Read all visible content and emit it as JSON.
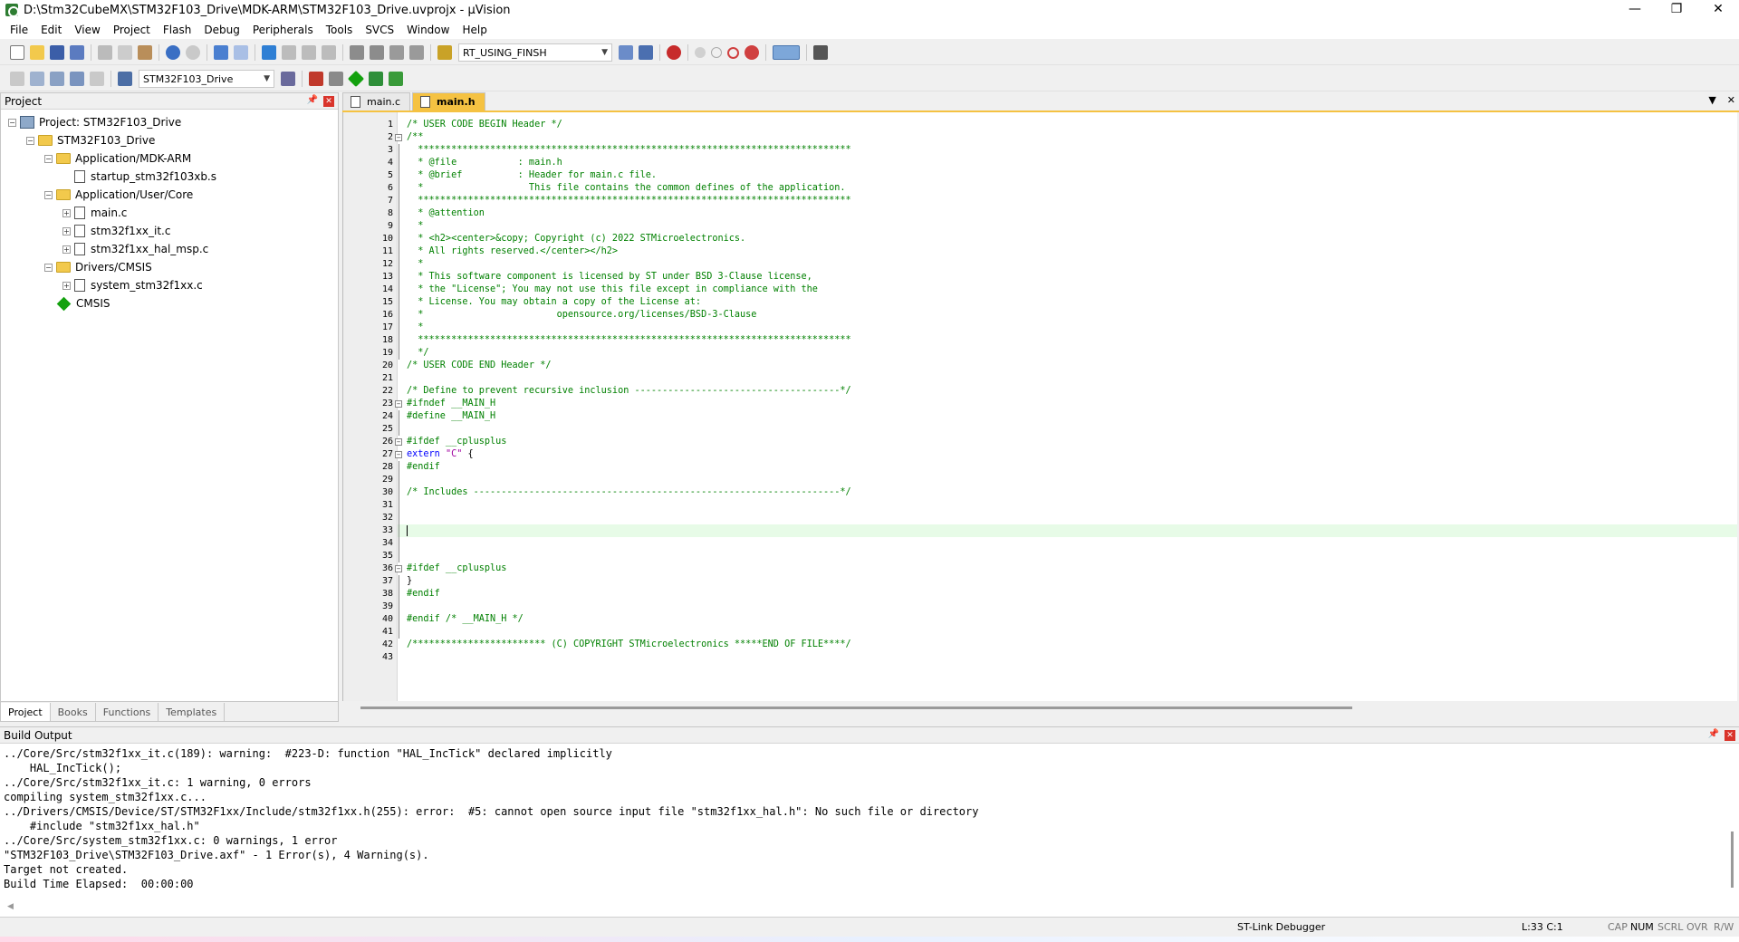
{
  "window": {
    "title": "D:\\Stm32CubeMX\\STM32F103_Drive\\MDK-ARM\\STM32F103_Drive.uvprojx - µVision",
    "min": "—",
    "max": "❐",
    "close": "✕"
  },
  "menu": [
    "File",
    "Edit",
    "View",
    "Project",
    "Flash",
    "Debug",
    "Peripherals",
    "Tools",
    "SVCS",
    "Window",
    "Help"
  ],
  "toolbar1": {
    "find_combo": "RT_USING_FINSH"
  },
  "toolbar2": {
    "target_combo": "STM32F103_Drive"
  },
  "project_panel": {
    "title": "Project",
    "tree": [
      {
        "label": "Project: STM32F103_Drive",
        "type": "project",
        "expander": "−",
        "level": 0
      },
      {
        "label": "STM32F103_Drive",
        "type": "folder",
        "expander": "−",
        "level": 1
      },
      {
        "label": "Application/MDK-ARM",
        "type": "folder",
        "expander": "−",
        "level": 2
      },
      {
        "label": "startup_stm32f103xb.s",
        "type": "file",
        "expander": "",
        "level": 3
      },
      {
        "label": "Application/User/Core",
        "type": "folder",
        "expander": "−",
        "level": 2
      },
      {
        "label": "main.c",
        "type": "file",
        "expander": "+",
        "level": 3
      },
      {
        "label": "stm32f1xx_it.c",
        "type": "file",
        "expander": "+",
        "level": 3
      },
      {
        "label": "stm32f1xx_hal_msp.c",
        "type": "file",
        "expander": "+",
        "level": 3
      },
      {
        "label": "Drivers/CMSIS",
        "type": "folder",
        "expander": "−",
        "level": 2
      },
      {
        "label": "system_stm32f1xx.c",
        "type": "file",
        "expander": "+",
        "level": 3
      },
      {
        "label": "CMSIS",
        "type": "component",
        "expander": "",
        "level": 2
      }
    ],
    "tabs": [
      "Project",
      "Books",
      "Functions",
      "Templates"
    ],
    "active_tab": "Project"
  },
  "editor": {
    "tabs": [
      "main.c",
      "main.h"
    ],
    "active_tab": "main.h",
    "lines": [
      {
        "n": "1",
        "t": "/* USER CODE BEGIN Header */",
        "c": "com",
        "f": ""
      },
      {
        "n": "2",
        "t": "/**",
        "c": "com",
        "f": "−"
      },
      {
        "n": "3",
        "t": "  ******************************************************************************",
        "c": "com",
        "f": "|"
      },
      {
        "n": "4",
        "t": "  * @file           : main.h",
        "c": "com",
        "f": "|"
      },
      {
        "n": "5",
        "t": "  * @brief          : Header for main.c file.",
        "c": "com",
        "f": "|"
      },
      {
        "n": "6",
        "t": "  *                   This file contains the common defines of the application.",
        "c": "com",
        "f": "|"
      },
      {
        "n": "7",
        "t": "  ******************************************************************************",
        "c": "com",
        "f": "|"
      },
      {
        "n": "8",
        "t": "  * @attention",
        "c": "com",
        "f": "|"
      },
      {
        "n": "9",
        "t": "  *",
        "c": "com",
        "f": "|"
      },
      {
        "n": "10",
        "t": "  * <h2><center>&copy; Copyright (c) 2022 STMicroelectronics.",
        "c": "com",
        "f": "|"
      },
      {
        "n": "11",
        "t": "  * All rights reserved.</center></h2>",
        "c": "com",
        "f": "|"
      },
      {
        "n": "12",
        "t": "  *",
        "c": "com",
        "f": "|"
      },
      {
        "n": "13",
        "t": "  * This software component is licensed by ST under BSD 3-Clause license,",
        "c": "com",
        "f": "|"
      },
      {
        "n": "14",
        "t": "  * the \"License\"; You may not use this file except in compliance with the",
        "c": "com",
        "f": "|"
      },
      {
        "n": "15",
        "t": "  * License. You may obtain a copy of the License at:",
        "c": "com",
        "f": "|"
      },
      {
        "n": "16",
        "t": "  *                        opensource.org/licenses/BSD-3-Clause",
        "c": "com",
        "f": "|"
      },
      {
        "n": "17",
        "t": "  *",
        "c": "com",
        "f": "|"
      },
      {
        "n": "18",
        "t": "  ******************************************************************************",
        "c": "com",
        "f": "|"
      },
      {
        "n": "19",
        "t": "  */",
        "c": "com",
        "f": "|"
      },
      {
        "n": "20",
        "t": "/* USER CODE END Header */",
        "c": "com",
        "f": ""
      },
      {
        "n": "21",
        "t": "",
        "c": "",
        "f": ""
      },
      {
        "n": "22",
        "t": "/* Define to prevent recursive inclusion -------------------------------------*/",
        "c": "com",
        "f": ""
      },
      {
        "n": "23",
        "t": "#ifndef __MAIN_H",
        "c": "pp",
        "f": "−"
      },
      {
        "n": "24",
        "t": "#define __MAIN_H",
        "c": "pp",
        "f": "|"
      },
      {
        "n": "25",
        "t": "",
        "c": "",
        "f": "|"
      },
      {
        "n": "26",
        "t": "#ifdef __cplusplus",
        "c": "pp",
        "f": "−"
      },
      {
        "n": "27",
        "t": "extern \"C\" {",
        "c": "kw",
        "f": "−"
      },
      {
        "n": "28",
        "t": "#endif",
        "c": "pp",
        "f": "|"
      },
      {
        "n": "29",
        "t": "",
        "c": "",
        "f": "|"
      },
      {
        "n": "30",
        "t": "/* Includes ------------------------------------------------------------------*/",
        "c": "com",
        "f": "|"
      },
      {
        "n": "31",
        "t": "",
        "c": "",
        "f": "|"
      },
      {
        "n": "32",
        "t": "",
        "c": "",
        "f": "|"
      },
      {
        "n": "33",
        "t": "",
        "c": "cur",
        "f": "|"
      },
      {
        "n": "34",
        "t": "",
        "c": "",
        "f": "|"
      },
      {
        "n": "35",
        "t": "",
        "c": "",
        "f": "|"
      },
      {
        "n": "36",
        "t": "#ifdef __cplusplus",
        "c": "pp",
        "f": "−"
      },
      {
        "n": "37",
        "t": "}",
        "c": "",
        "f": "|"
      },
      {
        "n": "38",
        "t": "#endif",
        "c": "pp",
        "f": "|"
      },
      {
        "n": "39",
        "t": "",
        "c": "",
        "f": "|"
      },
      {
        "n": "40",
        "t": "#endif /* __MAIN_H */",
        "c": "pp",
        "f": "|"
      },
      {
        "n": "41",
        "t": "",
        "c": "",
        "f": "|"
      },
      {
        "n": "42",
        "t": "/************************ (C) COPYRIGHT STMicroelectronics *****END OF FILE****/",
        "c": "com",
        "f": ""
      },
      {
        "n": "43",
        "t": "",
        "c": "",
        "f": ""
      }
    ]
  },
  "build_output": {
    "title": "Build Output",
    "lines": [
      "../Core/Src/stm32f1xx_it.c(189): warning:  #223-D: function \"HAL_IncTick\" declared implicitly",
      "    HAL_IncTick();",
      "../Core/Src/stm32f1xx_it.c: 1 warning, 0 errors",
      "compiling system_stm32f1xx.c...",
      "../Drivers/CMSIS/Device/ST/STM32F1xx/Include/stm32f1xx.h(255): error:  #5: cannot open source input file \"stm32f1xx_hal.h\": No such file or directory",
      "    #include \"stm32f1xx_hal.h\"",
      "../Core/Src/system_stm32f1xx.c: 0 warnings, 1 error",
      "\"STM32F103_Drive\\STM32F103_Drive.axf\" - 1 Error(s), 4 Warning(s).",
      "Target not created.",
      "Build Time Elapsed:  00:00:00"
    ]
  },
  "status": {
    "debugger": "ST-Link Debugger",
    "position": "L:33 C:1",
    "indicators": [
      "CAP",
      "NUM",
      "SCRL",
      "OVR",
      "R/W"
    ],
    "active_indicator": "NUM"
  }
}
